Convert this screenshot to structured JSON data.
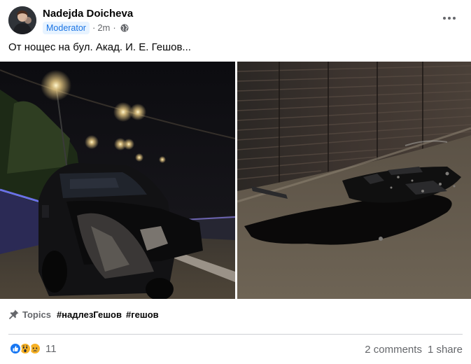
{
  "post": {
    "author": "Nadejda Doicheva",
    "role_badge": "Moderator",
    "separator": "·",
    "time": "2m",
    "caption": "От нощес на бул. Акад. И. Е. Гешов...",
    "topics_label": "Topics",
    "tags": [
      "#надлезГешов",
      "#гешов"
    ],
    "reaction_icons": [
      "like-reaction",
      "wow-reaction",
      "sad-reaction"
    ],
    "reaction_count": "11",
    "comments": "2 comments",
    "shares": "1 share",
    "colors": {
      "badge_bg": "#e7f3ff",
      "badge_text": "#1b74e4",
      "like": "#1877f2",
      "wow": "#f7b125",
      "muted": "#65676b"
    }
  }
}
